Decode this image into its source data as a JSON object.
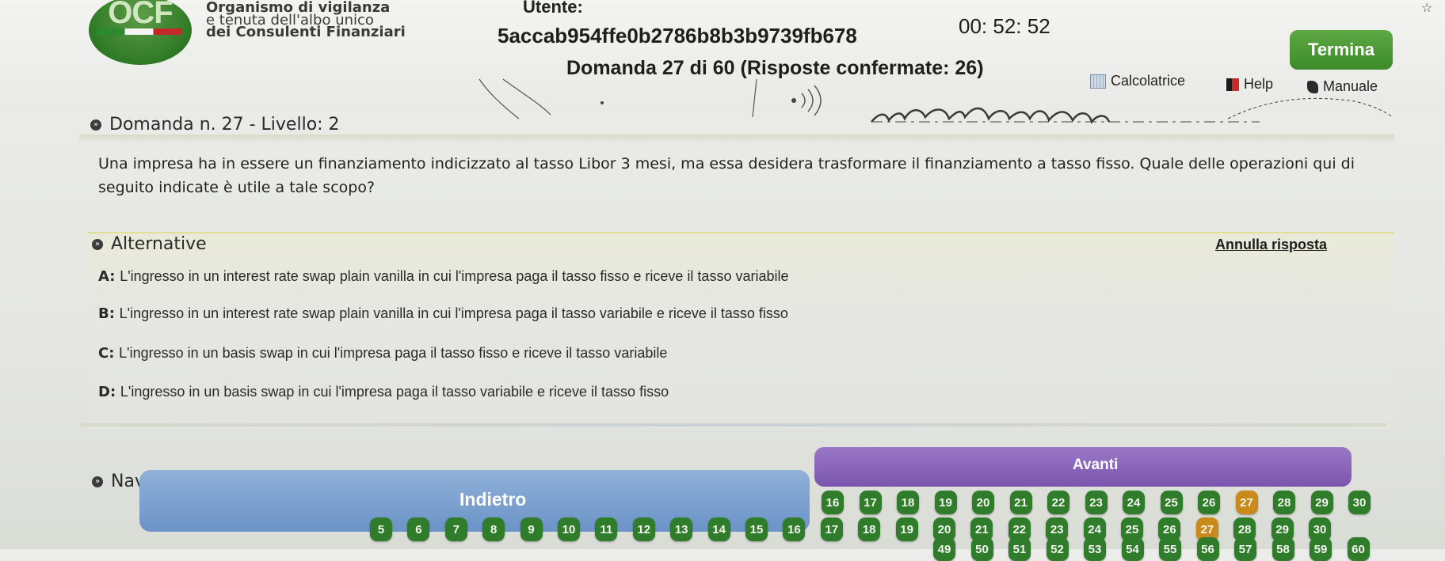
{
  "header": {
    "logo_text": "OCF",
    "org_line1": "Organismo di vigilanza",
    "org_line2": "e tenuta dell'albo unico",
    "org_line3": "dei Consulenti Finanziari",
    "user_label": "Utente:",
    "user_id": "5accab954ffe0b2786b8b3b9739fb678",
    "timer": "00: 52: 52",
    "termina_label": "Termina",
    "question_counter": "Domanda 27 di 60 (Risposte confermate: 26)",
    "tools": {
      "calculator_label": "Calcolatrice",
      "help_label": "Help",
      "manual_label": "Manuale"
    }
  },
  "question": {
    "heading": "Domanda n. 27 - Livello: 2",
    "text": "Una impresa ha in essere un finanziamento indicizzato al tasso Libor 3 mesi, ma essa desidera trasformare il finanziamento a tasso fisso. Quale delle operazioni qui di seguito indicate è utile a tale scopo?"
  },
  "alternatives": {
    "heading": "Alternative",
    "clear_label": "Annulla risposta",
    "options": [
      {
        "letter": "A:",
        "text": "L'ingresso in un interest rate swap plain vanilla in cui l'impresa paga il tasso fisso e riceve il tasso variabile"
      },
      {
        "letter": "B:",
        "text": "L'ingresso in un interest rate swap plain vanilla in cui l'impresa paga il tasso variabile e riceve il tasso fisso"
      },
      {
        "letter": "C:",
        "text": "L'ingresso in un basis swap in cui l'impresa paga il tasso fisso e riceve il tasso variabile"
      },
      {
        "letter": "D:",
        "text": "L'ingresso in un basis swap in cui l'impresa paga il tasso variabile e riceve il tasso fisso"
      }
    ]
  },
  "navigation": {
    "heading": "Navigazione",
    "back_label": "Indietro",
    "next_label": "Avanti",
    "current_question": "27",
    "row1": [
      "16",
      "17",
      "18",
      "19",
      "20",
      "21",
      "22",
      "23",
      "24",
      "25",
      "26",
      "27",
      "28",
      "29",
      "30"
    ],
    "row2": [
      "5",
      "6",
      "7",
      "8",
      "9",
      "10",
      "11",
      "12",
      "13",
      "14",
      "15",
      "16",
      "17",
      "18",
      "19",
      "20",
      "21",
      "22",
      "23",
      "24",
      "25",
      "26",
      "27",
      "28",
      "29",
      "30"
    ],
    "row3": [
      "49",
      "50",
      "51",
      "52",
      "53",
      "54",
      "55",
      "56",
      "57",
      "58",
      "59",
      "60"
    ]
  },
  "colors": {
    "accent_green": "#2f7d2a",
    "back_blue": "#7a9ed0",
    "next_purple": "#8a66bb",
    "current_orange": "#c98a1a"
  }
}
